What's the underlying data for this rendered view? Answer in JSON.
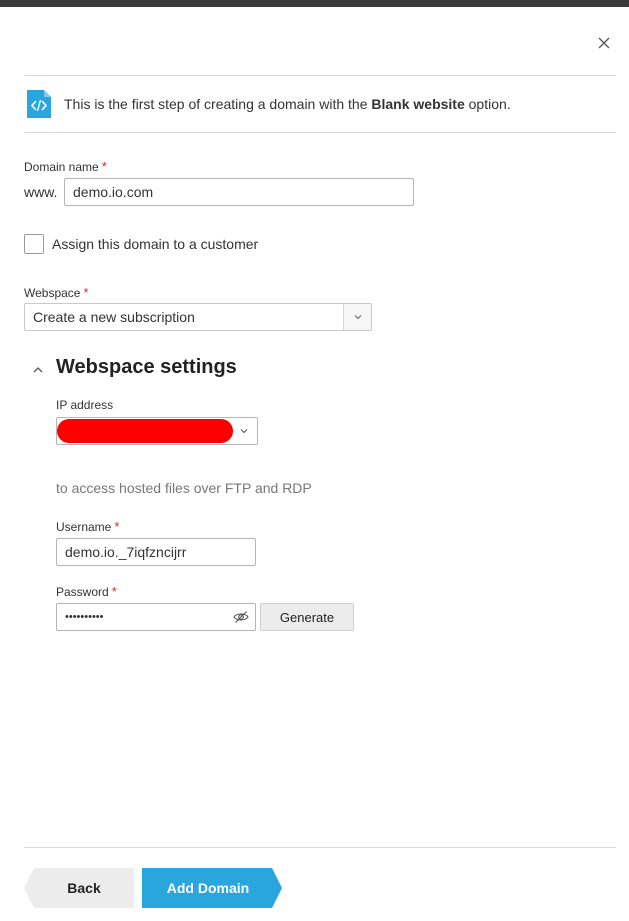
{
  "hint": {
    "text_before": "This is the first step of creating a domain with the ",
    "text_bold": "Blank website",
    "text_after": " option.",
    "icon": "code-file-icon"
  },
  "domain": {
    "label": "Domain name",
    "required_mark": "*",
    "prefix": "www.",
    "value": "demo.io.com"
  },
  "assign_customer": {
    "label": "Assign this domain to a customer",
    "checked": false
  },
  "webspace": {
    "label": "Webspace",
    "required_mark": "*",
    "selected": "Create a new subscription"
  },
  "webspace_settings": {
    "title": "Webspace settings",
    "ip_label": "IP address",
    "description": "to access hosted files over FTP and RDP",
    "username_label": "Username",
    "username_required": "*",
    "username_value": "demo.io._7iqfzncijrr",
    "password_label": "Password",
    "password_required": "*",
    "password_value": "••••••••••",
    "generate_label": "Generate"
  },
  "footer": {
    "back_label": "Back",
    "add_label": "Add Domain"
  },
  "colors": {
    "accent": "#29a6de",
    "required": "#d02b2b",
    "redacted": "#ff0000"
  }
}
